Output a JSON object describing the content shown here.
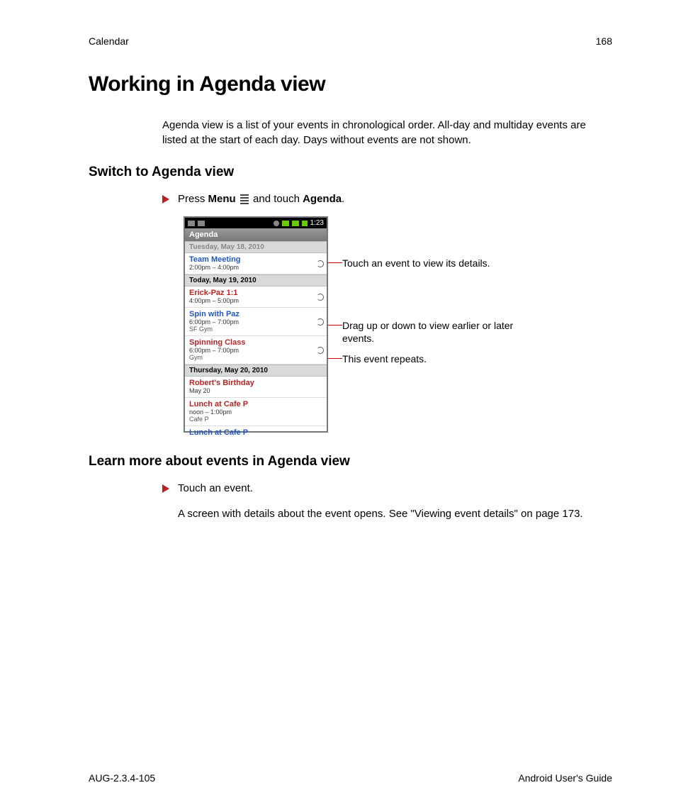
{
  "header": {
    "section": "Calendar",
    "page_number": "168"
  },
  "title": "Working in Agenda view",
  "intro": "Agenda view is a list of your events in chronological order. All-day and multiday events are listed at the start of each day. Days without events are not shown.",
  "sub1": "Switch to Agenda view",
  "action1": {
    "pre": "Press ",
    "bold1": "Menu",
    "mid": " and touch ",
    "bold2": "Agenda",
    "post": "."
  },
  "callouts": {
    "c1": "Touch an event to view its details.",
    "c2": "Drag up or down to view earlier or later events.",
    "c3": "This event repeats."
  },
  "screenshot": {
    "status_time": "1:23",
    "agenda_label": "Agenda",
    "day0": "Tuesday, May 18, 2010",
    "ev1": {
      "name": "Team Meeting",
      "time": "2:00pm – 4:00pm"
    },
    "day1": "Today, May 19, 2010",
    "ev2": {
      "name": "Erick-Paz 1:1",
      "time": "4:00pm – 5:00pm"
    },
    "ev3": {
      "name": "Spin with Paz",
      "time": "6:00pm – 7:00pm",
      "loc": "SF Gym"
    },
    "ev4": {
      "name": "Spinning Class",
      "time": "6:00pm – 7:00pm",
      "loc": "Gym"
    },
    "day2": "Thursday, May 20, 2010",
    "ev5": {
      "name": "Robert's Birthday",
      "time": "May 20"
    },
    "ev6": {
      "name": "Lunch at Cafe P",
      "time": "noon – 1:00pm",
      "loc": "Cafe P"
    },
    "ev7": {
      "name": "Lunch at Cafe P"
    }
  },
  "sub2": "Learn more about events in Agenda view",
  "action2": "Touch an event.",
  "after2": "A screen with details about the event opens. See \"Viewing event details\" on page 173.",
  "footer": {
    "left": "AUG-2.3.4-105",
    "right": "Android User's Guide"
  }
}
